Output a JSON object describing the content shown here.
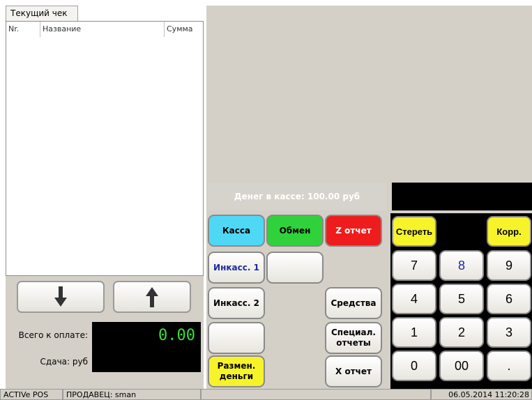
{
  "receipt": {
    "tab_label": "Текущий чек",
    "columns": [
      "Nr.",
      "Название",
      "Сумма"
    ],
    "total_label": "Всего к оплате:",
    "total_value": "0.00",
    "change_label": "Сдача: руб",
    "change_value": ""
  },
  "cash_info": "Денег в кассе: 100.00 руб",
  "display_value": "",
  "buttons": {
    "kassa": "Касса",
    "obmen": "Обмен",
    "z_report": "Z отчет",
    "inkass1": "Инкасс. 1",
    "inkass2": "Инкасс. 2",
    "sredstva": "Средства",
    "special_reports": "Специал. отчеты",
    "razmen": "Размен. деньги",
    "x_report": "X отчет"
  },
  "keypad": {
    "clear": "Стереть",
    "corr": "Корр.",
    "keys": [
      "7",
      "8",
      "9",
      "4",
      "5",
      "6",
      "1",
      "2",
      "3",
      "0",
      "00",
      "."
    ]
  },
  "status": {
    "app": "ACTIVe POS",
    "seller": "ПРОДАВЕЦ: sman",
    "datetime": "06.05.2014 11:20:28"
  },
  "colors": {
    "kassa": "#4fd8f5",
    "obmen": "#2fd23a",
    "z_report": "#ee1c1c",
    "yellow": "#f7f32b",
    "panel": "#d4d0c8"
  }
}
